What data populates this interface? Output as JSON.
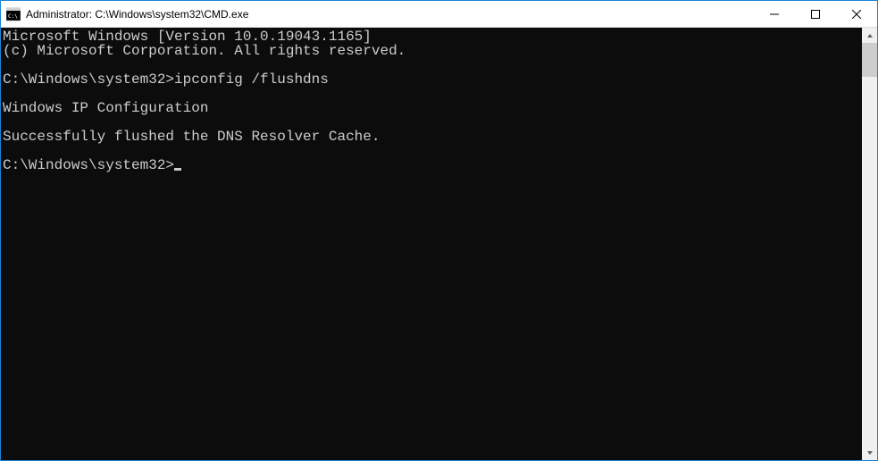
{
  "titlebar": {
    "title": "Administrator: C:\\Windows\\system32\\CMD.exe"
  },
  "console": {
    "lines": [
      "Microsoft Windows [Version 10.0.19043.1165]",
      "(c) Microsoft Corporation. All rights reserved.",
      "",
      "C:\\Windows\\system32>ipconfig /flushdns",
      "",
      "Windows IP Configuration",
      "",
      "Successfully flushed the DNS Resolver Cache.",
      ""
    ],
    "prompt": "C:\\Windows\\system32>"
  }
}
